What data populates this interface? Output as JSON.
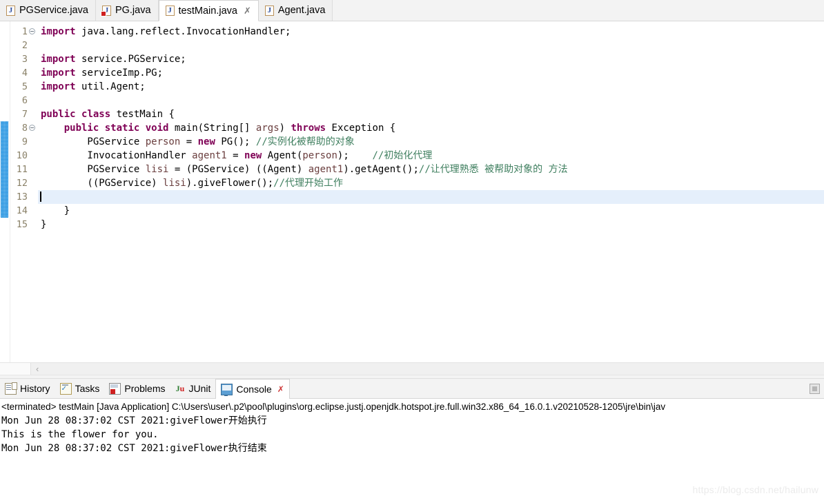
{
  "editor_tabs": [
    {
      "label": "PGService.java",
      "icon": "java-file-icon",
      "active": false,
      "error": false,
      "closable": false
    },
    {
      "label": "PG.java",
      "icon": "java-file-error-icon",
      "active": false,
      "error": true,
      "closable": false
    },
    {
      "label": "testMain.java",
      "icon": "java-file-icon",
      "active": true,
      "error": false,
      "closable": true,
      "close_glyph": "✗"
    },
    {
      "label": "Agent.java",
      "icon": "java-file-icon",
      "active": false,
      "error": false,
      "closable": false
    }
  ],
  "editor": {
    "active_file": "testMain.java",
    "current_line": 13,
    "changed_line_range": [
      8,
      14
    ],
    "fold_lines": [
      1,
      8
    ],
    "scroll_left_arrow": "‹",
    "lines": [
      {
        "num": 1,
        "tokens": [
          {
            "t": "import ",
            "c": "kw"
          },
          {
            "t": "java.lang.reflect.InvocationHandler;",
            "c": "pln"
          }
        ]
      },
      {
        "num": 2,
        "tokens": []
      },
      {
        "num": 3,
        "tokens": [
          {
            "t": "import ",
            "c": "kw"
          },
          {
            "t": "service.PGService;",
            "c": "pln"
          }
        ]
      },
      {
        "num": 4,
        "tokens": [
          {
            "t": "import ",
            "c": "kw"
          },
          {
            "t": "serviceImp.PG;",
            "c": "pln"
          }
        ]
      },
      {
        "num": 5,
        "tokens": [
          {
            "t": "import ",
            "c": "kw"
          },
          {
            "t": "util.Agent;",
            "c": "pln"
          }
        ]
      },
      {
        "num": 6,
        "tokens": []
      },
      {
        "num": 7,
        "tokens": [
          {
            "t": "public ",
            "c": "kw"
          },
          {
            "t": "class ",
            "c": "kw"
          },
          {
            "t": "testMain {",
            "c": "pln"
          }
        ]
      },
      {
        "num": 8,
        "tokens": [
          {
            "t": "    ",
            "c": "pln"
          },
          {
            "t": "public ",
            "c": "kw"
          },
          {
            "t": "static ",
            "c": "kw"
          },
          {
            "t": "void ",
            "c": "kw"
          },
          {
            "t": "main(String[] ",
            "c": "pln"
          },
          {
            "t": "args",
            "c": "lv"
          },
          {
            "t": ") ",
            "c": "pln"
          },
          {
            "t": "throws ",
            "c": "kw"
          },
          {
            "t": "Exception {",
            "c": "pln"
          }
        ]
      },
      {
        "num": 9,
        "tokens": [
          {
            "t": "        PGService ",
            "c": "pln"
          },
          {
            "t": "person",
            "c": "lv"
          },
          {
            "t": " = ",
            "c": "pln"
          },
          {
            "t": "new ",
            "c": "kw"
          },
          {
            "t": "PG(); ",
            "c": "pln"
          },
          {
            "t": "//实例化被帮助的对象",
            "c": "cm"
          }
        ]
      },
      {
        "num": 10,
        "tokens": [
          {
            "t": "        InvocationHandler ",
            "c": "pln"
          },
          {
            "t": "agent1",
            "c": "lv"
          },
          {
            "t": " = ",
            "c": "pln"
          },
          {
            "t": "new ",
            "c": "kw"
          },
          {
            "t": "Agent(",
            "c": "pln"
          },
          {
            "t": "person",
            "c": "lv"
          },
          {
            "t": ");    ",
            "c": "pln"
          },
          {
            "t": "//初始化代理",
            "c": "cm"
          }
        ]
      },
      {
        "num": 11,
        "tokens": [
          {
            "t": "        PGService ",
            "c": "pln"
          },
          {
            "t": "lisi",
            "c": "lv"
          },
          {
            "t": " = (PGService) ((Agent) ",
            "c": "pln"
          },
          {
            "t": "agent1",
            "c": "lv"
          },
          {
            "t": ").getAgent();",
            "c": "pln"
          },
          {
            "t": "//让代理熟悉 被帮助对象的 方法",
            "c": "cm"
          }
        ]
      },
      {
        "num": 12,
        "tokens": [
          {
            "t": "        ((PGService) ",
            "c": "pln"
          },
          {
            "t": "lisi",
            "c": "lv"
          },
          {
            "t": ").giveFlower();",
            "c": "pln"
          },
          {
            "t": "//代理开始工作",
            "c": "cm"
          }
        ]
      },
      {
        "num": 13,
        "tokens": []
      },
      {
        "num": 14,
        "tokens": [
          {
            "t": "    }",
            "c": "pln"
          }
        ]
      },
      {
        "num": 15,
        "tokens": [
          {
            "t": "}",
            "c": "pln"
          }
        ]
      }
    ]
  },
  "bottom_tabs": [
    {
      "label": "History",
      "icon": "history-icon",
      "active": false,
      "closable": false
    },
    {
      "label": "Tasks",
      "icon": "tasks-icon",
      "active": false,
      "closable": false
    },
    {
      "label": "Problems",
      "icon": "problems-icon",
      "active": false,
      "closable": false
    },
    {
      "label": "JUnit",
      "icon": "junit-icon",
      "active": false,
      "closable": false
    },
    {
      "label": "Console",
      "icon": "console-icon",
      "active": true,
      "closable": true,
      "close_glyph": "✗"
    }
  ],
  "console": {
    "header": "<terminated> testMain [Java Application] C:\\Users\\user\\.p2\\pool\\plugins\\org.eclipse.justj.openjdk.hotspot.jre.full.win32.x86_64_16.0.1.v20210528-1205\\jre\\bin\\jav",
    "output_lines": [
      "Mon Jun 28 08:37:02 CST 2021:giveFlower开始执行",
      "This is the flower for you.",
      "Mon Jun 28 08:37:02 CST 2021:giveFlower执行结束"
    ],
    "minimize_button": "minimize-restore-button"
  },
  "watermark": "https://blog.csdn.net/hailunw",
  "colors": {
    "keyword": "#7f0055",
    "comment": "#3f7f5f",
    "local_var": "#6a3e3e",
    "current_line_bg": "#e5effb",
    "change_bar": "#1e90e0",
    "gutter_text": "#8a8168"
  }
}
